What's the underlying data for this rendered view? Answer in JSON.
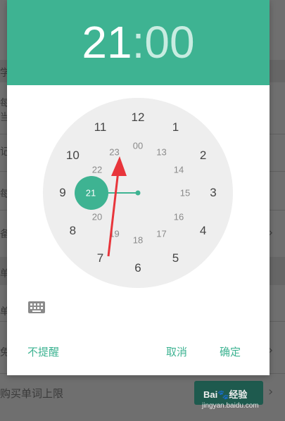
{
  "time_picker": {
    "hour": "21",
    "separator": ":",
    "minute": "00",
    "outer_numbers": [
      "12",
      "1",
      "2",
      "3",
      "4",
      "5",
      "6",
      "7",
      "8",
      "9",
      "10",
      "11"
    ],
    "inner_numbers": [
      "00",
      "13",
      "14",
      "15",
      "16",
      "17",
      "18",
      "19",
      "20",
      "21",
      "22",
      "23"
    ],
    "selected_hour": "21"
  },
  "dialog_buttons": {
    "no_reminder": "不提醒",
    "cancel": "取消",
    "confirm": "确定"
  },
  "background": {
    "visible_chars": [
      "学",
      "每",
      "当",
      "记",
      "每",
      "备",
      "单",
      "单",
      "免"
    ],
    "bottom_label": "购买单词上限"
  },
  "watermark": {
    "brand": "Bai",
    "brand_suffix": "经验",
    "url": "jingyan.baidu.com"
  },
  "colors": {
    "accent": "#3eb392",
    "annotation_arrow": "#e8353b"
  }
}
